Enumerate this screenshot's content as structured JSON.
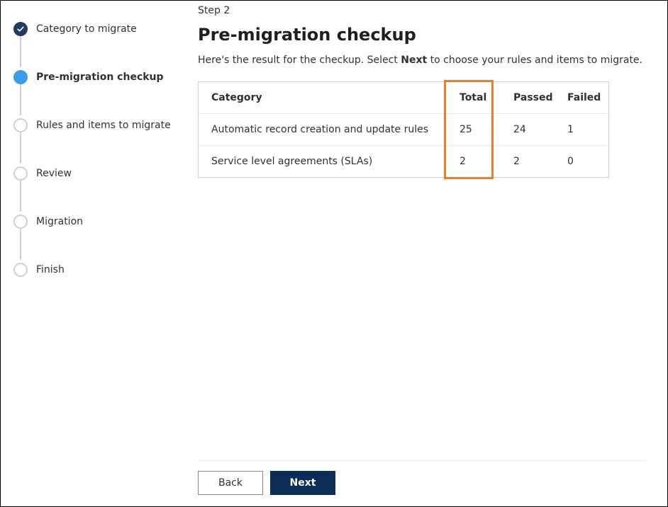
{
  "sidebar": {
    "steps": [
      {
        "label": "Category to migrate",
        "state": "done"
      },
      {
        "label": "Pre-migration checkup",
        "state": "current"
      },
      {
        "label": "Rules and items to migrate",
        "state": "pending"
      },
      {
        "label": "Review",
        "state": "pending"
      },
      {
        "label": "Migration",
        "state": "pending"
      },
      {
        "label": "Finish",
        "state": "pending"
      }
    ]
  },
  "main": {
    "step_indicator": "Step 2",
    "title": "Pre-migration checkup",
    "subtitle_prefix": "Here's the result for the checkup. Select ",
    "subtitle_bold": "Next",
    "subtitle_suffix": " to choose your rules and items to migrate.",
    "table": {
      "headers": {
        "category": "Category",
        "total": "Total",
        "passed": "Passed",
        "failed": "Failed"
      },
      "rows": [
        {
          "category": "Automatic record creation and update rules",
          "total": "25",
          "passed": "24",
          "failed": "1"
        },
        {
          "category": "Service level agreements (SLAs)",
          "total": "2",
          "passed": "2",
          "failed": "0"
        }
      ]
    }
  },
  "footer": {
    "back": "Back",
    "next": "Next"
  }
}
